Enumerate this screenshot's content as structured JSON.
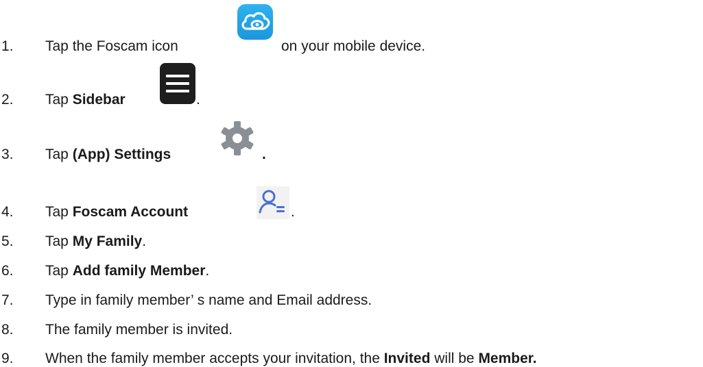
{
  "steps": [
    {
      "num": "1.",
      "pre": "Tap the Foscam icon",
      "bold": "",
      "post": "on your mobile device.",
      "icon": "foscam-cloud-icon"
    },
    {
      "num": "2.",
      "pre": "Tap ",
      "bold": "Sidebar",
      "post": ".",
      "icon": "menu-icon"
    },
    {
      "num": "3.",
      "pre": "Tap ",
      "bold": "(App) Settings",
      "post": ".",
      "icon": "gear-icon"
    },
    {
      "num": "4.",
      "pre": "Tap ",
      "bold": "Foscam Account",
      "post": ".",
      "icon": "account-icon"
    },
    {
      "num": "5.",
      "pre": "Tap ",
      "bold": "My Family",
      "post": "."
    },
    {
      "num": "6.",
      "pre": "Tap ",
      "bold": "Add family Member",
      "post": "."
    },
    {
      "num": "7.",
      "pre": "Type in family member’ s name and Email address.",
      "bold": "",
      "post": ""
    },
    {
      "num": "8.",
      "pre": "The family member is invited.",
      "bold": "",
      "post": ""
    },
    {
      "num": "9.",
      "pre": "When the family member accepts your invitation, the ",
      "bold": "Invited",
      "mid": " will be ",
      "bold2": "Member."
    }
  ],
  "colors": {
    "foscam_icon": "#1a96de",
    "menu_icon": "#1e1e1e",
    "gear_icon": "#8a8f96",
    "account_icon": "#4a6fd0"
  }
}
